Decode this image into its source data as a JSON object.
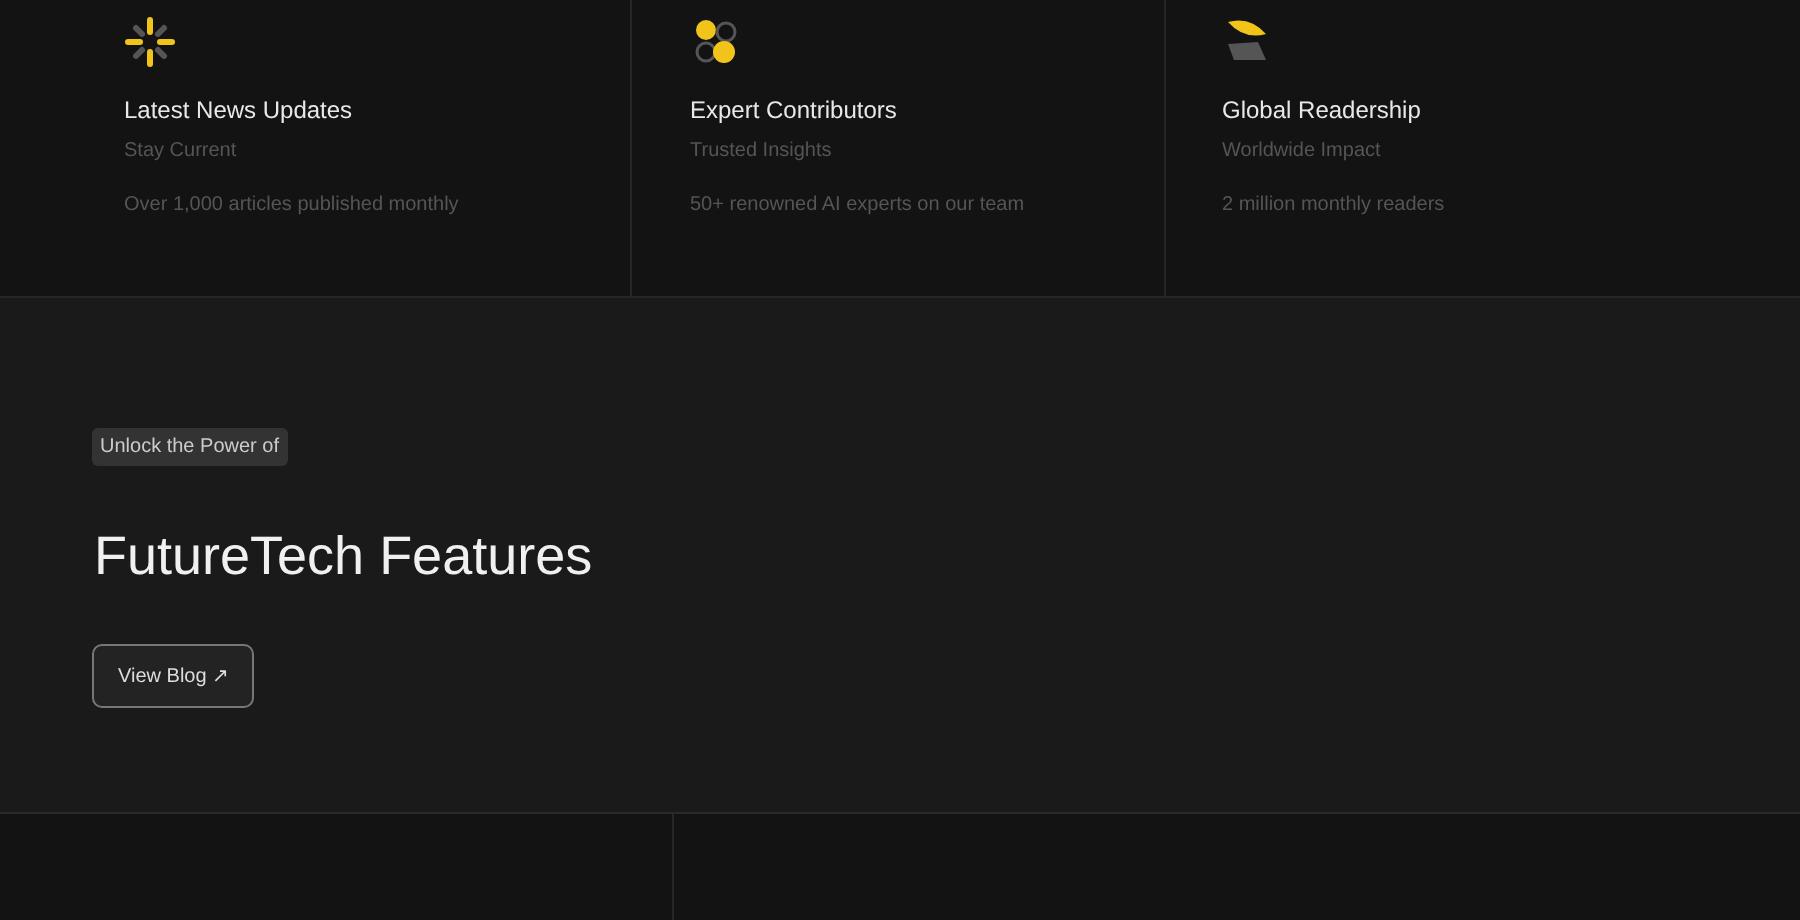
{
  "stats": [
    {
      "kind": "burst",
      "title": "Latest News Updates",
      "subtitle": "Stay Current",
      "detail": "Over 1,000 articles published monthly"
    },
    {
      "kind": "circles",
      "title": "Expert Contributors",
      "subtitle": "Trusted Insights",
      "detail": "50+ renowned AI experts on our team"
    },
    {
      "kind": "leaves",
      "title": "Global Readership",
      "subtitle": "Worldwide Impact",
      "detail": "2 million monthly readers"
    }
  ],
  "hero": {
    "tag": "Unlock the Power of",
    "heading": "FutureTech Features",
    "button": "View Blog ↗"
  }
}
